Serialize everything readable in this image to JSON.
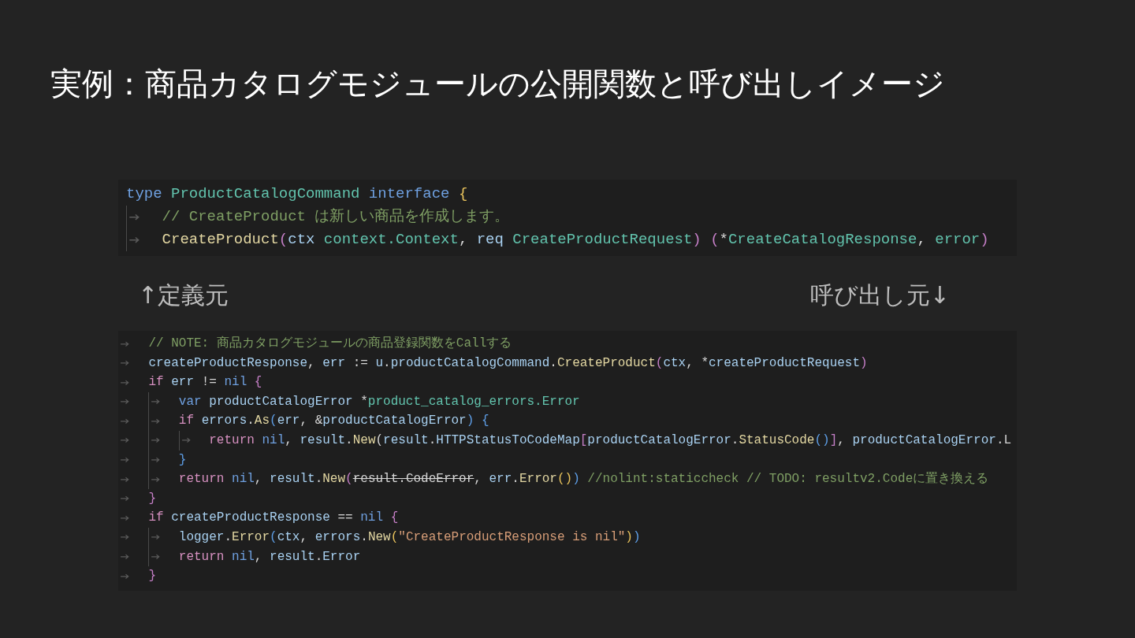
{
  "title": "実例：商品カタログモジュールの公開関数と呼び出しイメージ",
  "definition_snippet": {
    "leading_tab": false,
    "lines": [
      {
        "tokens": [
          {
            "t": "type ",
            "kind": "kw"
          },
          {
            "t": "ProductCatalogCommand ",
            "kind": "type"
          },
          {
            "t": "interface ",
            "kind": "kw"
          },
          {
            "t": "{",
            "kind": "p1"
          }
        ],
        "children": [
          {
            "tokens": [
              {
                "t": "// CreateProduct は新しい商品を作成します。",
                "kind": "comment"
              }
            ]
          },
          {
            "tokens": [
              {
                "t": "CreateProduct",
                "kind": "fn"
              },
              {
                "t": "(",
                "kind": "p2"
              },
              {
                "t": "ctx ",
                "kind": "var"
              },
              {
                "t": "context.Context",
                "kind": "type"
              },
              {
                "t": ", ",
                "kind": "plain"
              },
              {
                "t": "req ",
                "kind": "var"
              },
              {
                "t": "CreateProductRequest",
                "kind": "type"
              },
              {
                "t": ") (",
                "kind": "p2"
              },
              {
                "t": "*",
                "kind": "plain"
              },
              {
                "t": "CreateCatalogResponse",
                "kind": "type"
              },
              {
                "t": ", ",
                "kind": "plain"
              },
              {
                "t": "error",
                "kind": "type"
              },
              {
                "t": ")",
                "kind": "p2"
              }
            ]
          }
        ]
      }
    ]
  },
  "definition_label": "↑定義元",
  "caller_label": "呼び出し元↓",
  "caller_snippet": {
    "leading_tab": true,
    "lines": [
      {
        "tokens": [
          {
            "t": "// NOTE: 商品カタログモジュールの商品登録関数をCallする",
            "kind": "comment"
          }
        ]
      },
      {
        "tokens": [
          {
            "t": "createProductResponse",
            "kind": "var"
          },
          {
            "t": ", ",
            "kind": "plain"
          },
          {
            "t": "err",
            "kind": "var"
          },
          {
            "t": " := ",
            "kind": "plain"
          },
          {
            "t": "u",
            "kind": "var"
          },
          {
            "t": ".",
            "kind": "plain"
          },
          {
            "t": "productCatalogCommand",
            "kind": "var"
          },
          {
            "t": ".",
            "kind": "plain"
          },
          {
            "t": "CreateProduct",
            "kind": "fn"
          },
          {
            "t": "(",
            "kind": "p2"
          },
          {
            "t": "ctx",
            "kind": "var"
          },
          {
            "t": ", *",
            "kind": "plain"
          },
          {
            "t": "createProductRequest",
            "kind": "var"
          },
          {
            "t": ")",
            "kind": "p2"
          }
        ]
      },
      {
        "tokens": [
          {
            "t": "if ",
            "kind": "ctrl"
          },
          {
            "t": "err",
            "kind": "var"
          },
          {
            "t": " != ",
            "kind": "plain"
          },
          {
            "t": "nil ",
            "kind": "kw"
          },
          {
            "t": "{",
            "kind": "p2"
          }
        ],
        "children": [
          {
            "tokens": [
              {
                "t": "var ",
                "kind": "kw"
              },
              {
                "t": "productCatalogError",
                "kind": "var"
              },
              {
                "t": " *",
                "kind": "plain"
              },
              {
                "t": "product_catalog_errors.Error",
                "kind": "type"
              }
            ]
          },
          {
            "tokens": [
              {
                "t": "if ",
                "kind": "ctrl"
              },
              {
                "t": "errors",
                "kind": "var"
              },
              {
                "t": ".",
                "kind": "plain"
              },
              {
                "t": "As",
                "kind": "fn"
              },
              {
                "t": "(",
                "kind": "p3"
              },
              {
                "t": "err",
                "kind": "var"
              },
              {
                "t": ", &",
                "kind": "plain"
              },
              {
                "t": "productCatalogError",
                "kind": "var"
              },
              {
                "t": ") {",
                "kind": "p3"
              }
            ],
            "children": [
              {
                "tokens": [
                  {
                    "t": "return ",
                    "kind": "ctrl"
                  },
                  {
                    "t": "nil",
                    "kind": "kw"
                  },
                  {
                    "t": ", ",
                    "kind": "plain"
                  },
                  {
                    "t": "result",
                    "kind": "var"
                  },
                  {
                    "t": ".",
                    "kind": "plain"
                  },
                  {
                    "t": "New",
                    "kind": "fn"
                  },
                  {
                    "t": "(",
                    "kind": "plain"
                  },
                  {
                    "t": "result",
                    "kind": "var"
                  },
                  {
                    "t": ".",
                    "kind": "plain"
                  },
                  {
                    "t": "HTTPStatusToCodeMap",
                    "kind": "var"
                  },
                  {
                    "t": "[",
                    "kind": "p2"
                  },
                  {
                    "t": "productCatalogError",
                    "kind": "var"
                  },
                  {
                    "t": ".",
                    "kind": "plain"
                  },
                  {
                    "t": "StatusCode",
                    "kind": "fn"
                  },
                  {
                    "t": "()",
                    "kind": "p3"
                  },
                  {
                    "t": "]",
                    "kind": "p2"
                  },
                  {
                    "t": ", ",
                    "kind": "plain"
                  },
                  {
                    "t": "productCatalogError",
                    "kind": "var"
                  },
                  {
                    "t": ".L",
                    "kind": "plain"
                  }
                ]
              }
            ]
          },
          {
            "tokens": [
              {
                "t": "}",
                "kind": "p3"
              }
            ]
          },
          {
            "tokens": [
              {
                "t": "return ",
                "kind": "ctrl"
              },
              {
                "t": "nil",
                "kind": "kw"
              },
              {
                "t": ", ",
                "kind": "plain"
              },
              {
                "t": "result",
                "kind": "var"
              },
              {
                "t": ".",
                "kind": "plain"
              },
              {
                "t": "New",
                "kind": "fn"
              },
              {
                "t": "(",
                "kind": "p2"
              },
              {
                "t": "result.CodeError",
                "kind": "deprecated"
              },
              {
                "t": ", ",
                "kind": "plain"
              },
              {
                "t": "err",
                "kind": "var"
              },
              {
                "t": ".",
                "kind": "plain"
              },
              {
                "t": "Error",
                "kind": "fn"
              },
              {
                "t": "()",
                "kind": "p1"
              },
              {
                "t": ") ",
                "kind": "p3"
              },
              {
                "t": "//nolint:staticcheck // TODO: resultv2.Codeに置き換える",
                "kind": "comment"
              }
            ]
          }
        ]
      },
      {
        "tokens": [
          {
            "t": "}",
            "kind": "p2"
          }
        ]
      },
      {
        "tokens": [
          {
            "t": "if ",
            "kind": "ctrl"
          },
          {
            "t": "createProductResponse",
            "kind": "var"
          },
          {
            "t": " == ",
            "kind": "plain"
          },
          {
            "t": "nil ",
            "kind": "kw"
          },
          {
            "t": "{",
            "kind": "p2"
          }
        ],
        "children": [
          {
            "tokens": [
              {
                "t": "logger",
                "kind": "var"
              },
              {
                "t": ".",
                "kind": "plain"
              },
              {
                "t": "Error",
                "kind": "fn"
              },
              {
                "t": "(",
                "kind": "p3"
              },
              {
                "t": "ctx",
                "kind": "var"
              },
              {
                "t": ", ",
                "kind": "plain"
              },
              {
                "t": "errors",
                "kind": "var"
              },
              {
                "t": ".",
                "kind": "plain"
              },
              {
                "t": "New",
                "kind": "fn"
              },
              {
                "t": "(",
                "kind": "p1"
              },
              {
                "t": "\"CreateProductResponse is nil\"",
                "kind": "str"
              },
              {
                "t": ")",
                "kind": "p1"
              },
              {
                "t": ")",
                "kind": "p3"
              }
            ]
          },
          {
            "tokens": [
              {
                "t": "return ",
                "kind": "ctrl"
              },
              {
                "t": "nil",
                "kind": "kw"
              },
              {
                "t": ", ",
                "kind": "plain"
              },
              {
                "t": "result",
                "kind": "var"
              },
              {
                "t": ".",
                "kind": "plain"
              },
              {
                "t": "Error",
                "kind": "var"
              }
            ]
          }
        ]
      },
      {
        "tokens": [
          {
            "t": "}",
            "kind": "p2"
          }
        ]
      }
    ]
  }
}
